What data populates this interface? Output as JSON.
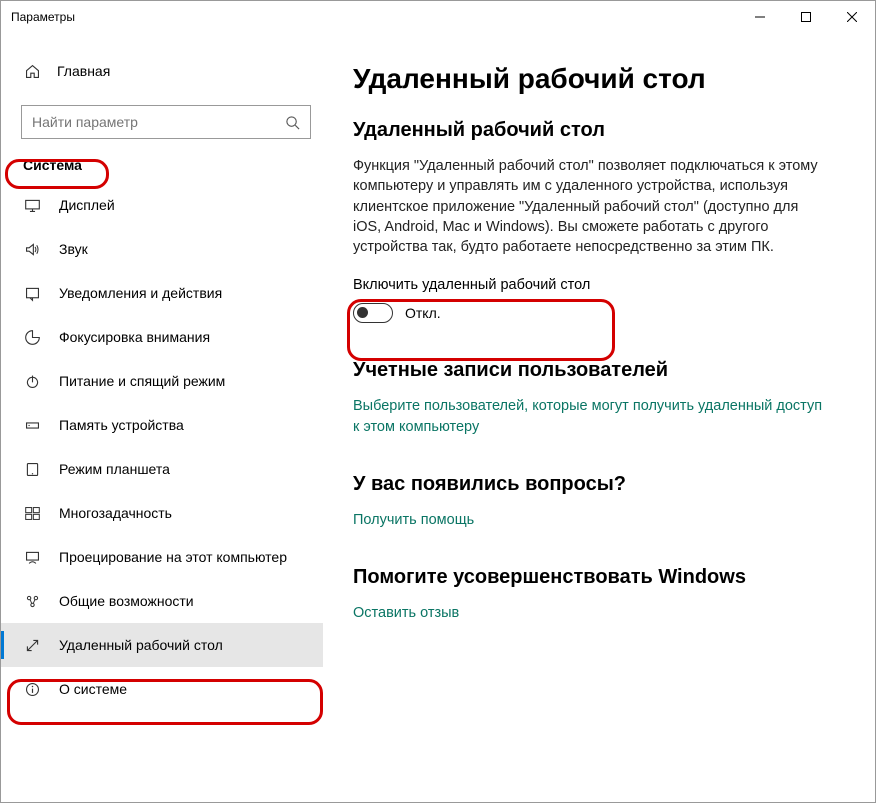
{
  "window": {
    "title": "Параметры"
  },
  "sidebar": {
    "home_label": "Главная",
    "search_placeholder": "Найти параметр",
    "section_label": "Система",
    "items": [
      {
        "label": "Дисплей"
      },
      {
        "label": "Звук"
      },
      {
        "label": "Уведомления и действия"
      },
      {
        "label": "Фокусировка внимания"
      },
      {
        "label": "Питание и спящий режим"
      },
      {
        "label": "Память устройства"
      },
      {
        "label": "Режим планшета"
      },
      {
        "label": "Многозадачность"
      },
      {
        "label": "Проецирование на этот компьютер"
      },
      {
        "label": "Общие возможности"
      },
      {
        "label": "Удаленный рабочий стол"
      },
      {
        "label": "О системе"
      }
    ]
  },
  "content": {
    "page_title": "Удаленный рабочий стол",
    "section1_title": "Удаленный рабочий стол",
    "section1_body": "Функция \"Удаленный рабочий стол\" позволяет подключаться к этому компьютеру и управлять им с удаленного устройства, используя клиентское приложение \"Удаленный рабочий стол\" (доступно для iOS, Android, Mac и Windows). Вы сможете работать с другого устройства так, будто работаете непосредственно за этим ПК.",
    "toggle_label": "Включить удаленный рабочий стол",
    "toggle_state": "Откл.",
    "section2_title": "Учетные записи пользователей",
    "section2_link": "Выберите пользователей, которые могут получить удаленный доступ к этом компьютеру",
    "section3_title": "У вас появились вопросы?",
    "section3_link": "Получить помощь",
    "section4_title": "Помогите усовершенствовать Windows",
    "section4_link": "Оставить отзыв"
  }
}
